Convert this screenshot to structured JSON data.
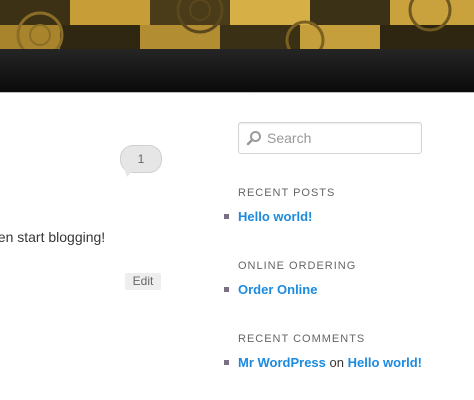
{
  "main": {
    "comment_count": "1",
    "post_excerpt": "hen start blogging!",
    "edit_label": "Edit"
  },
  "sidebar": {
    "search": {
      "placeholder": "Search"
    },
    "recent_posts": {
      "title": "RECENT POSTS",
      "items": [
        "Hello world!"
      ]
    },
    "online_ordering": {
      "title": "ONLINE ORDERING",
      "items": [
        "Order Online"
      ]
    },
    "recent_comments": {
      "title": "RECENT COMMENTS",
      "author": "Mr WordPress",
      "on": "on",
      "post": "Hello world!"
    }
  },
  "colors": {
    "link": "#1b8be0",
    "nav_bar": "#111111",
    "bullet": "#7b6f84"
  }
}
